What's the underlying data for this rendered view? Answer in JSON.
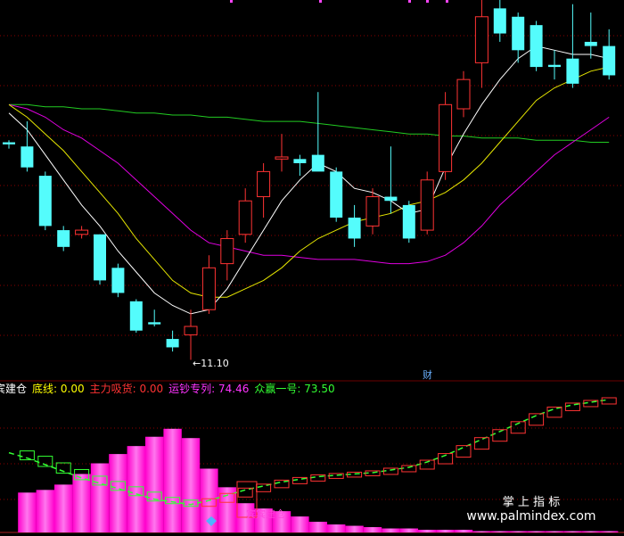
{
  "indicator_legend": [
    {
      "name": "宾建仓",
      "value": "",
      "color": "#ffffff"
    },
    {
      "name": "底线",
      "value": "0.00",
      "color": "#ffff00"
    },
    {
      "name": "主力吸货",
      "value": "0.00",
      "color": "#ff3333"
    },
    {
      "name": "运钞专列",
      "value": "74.46",
      "color": "#ff33ff"
    },
    {
      "name": "众赢一号",
      "value": "73.50",
      "color": "#33ff33"
    }
  ],
  "annotations": {
    "low_price": "←11.10",
    "finance_marker": "财",
    "buy_signal": "宾宾建仓"
  },
  "watermark": {
    "line1": "掌 上 指 标",
    "line2": "www.palmindex.com"
  },
  "colors": {
    "up": "#ff3333",
    "down": "#54fcfc",
    "ma_white": "#ffffff",
    "ma_yellow": "#e6e600",
    "ma_magenta": "#e000e0",
    "ma_green": "#22cc22",
    "bars": "#ff33cc",
    "grid": "#8b0000"
  },
  "chart_data": [
    {
      "type": "candlestick",
      "title": "",
      "yrange": [
        10.6,
        19.7
      ],
      "candles": [
        {
          "o": 16.3,
          "h": 16.35,
          "l": 16.15,
          "c": 16.25
        },
        {
          "o": 16.2,
          "h": 16.8,
          "l": 15.6,
          "c": 15.7
        },
        {
          "o": 15.5,
          "h": 15.6,
          "l": 14.2,
          "c": 14.3
        },
        {
          "o": 14.2,
          "h": 14.3,
          "l": 13.7,
          "c": 13.8
        },
        {
          "o": 14.1,
          "h": 14.3,
          "l": 14.0,
          "c": 14.2
        },
        {
          "o": 14.1,
          "h": 14.1,
          "l": 12.9,
          "c": 13.0
        },
        {
          "o": 13.3,
          "h": 13.4,
          "l": 12.6,
          "c": 12.7
        },
        {
          "o": 12.5,
          "h": 12.55,
          "l": 11.75,
          "c": 11.8
        },
        {
          "o": 12.0,
          "h": 12.3,
          "l": 11.9,
          "c": 11.95
        },
        {
          "o": 11.6,
          "h": 11.8,
          "l": 11.3,
          "c": 11.4
        },
        {
          "o": 11.7,
          "h": 12.3,
          "l": 11.1,
          "c": 11.9
        },
        {
          "o": 12.3,
          "h": 13.6,
          "l": 12.2,
          "c": 13.3
        },
        {
          "o": 13.4,
          "h": 14.2,
          "l": 13.0,
          "c": 14.0
        },
        {
          "o": 14.1,
          "h": 15.2,
          "l": 13.9,
          "c": 14.9
        },
        {
          "o": 15.0,
          "h": 15.8,
          "l": 14.5,
          "c": 15.6
        },
        {
          "o": 15.9,
          "h": 16.5,
          "l": 15.6,
          "c": 15.95
        },
        {
          "o": 15.9,
          "h": 16.0,
          "l": 15.5,
          "c": 15.8
        },
        {
          "o": 16.0,
          "h": 17.5,
          "l": 15.7,
          "c": 15.6
        },
        {
          "o": 15.6,
          "h": 15.7,
          "l": 14.4,
          "c": 14.5
        },
        {
          "o": 14.5,
          "h": 14.8,
          "l": 13.8,
          "c": 14.0
        },
        {
          "o": 14.3,
          "h": 15.2,
          "l": 14.1,
          "c": 15.0
        },
        {
          "o": 15.0,
          "h": 16.2,
          "l": 14.6,
          "c": 14.9
        },
        {
          "o": 14.8,
          "h": 14.9,
          "l": 13.9,
          "c": 14.0
        },
        {
          "o": 14.2,
          "h": 15.6,
          "l": 14.1,
          "c": 15.4
        },
        {
          "o": 15.6,
          "h": 17.5,
          "l": 15.4,
          "c": 17.2
        },
        {
          "o": 17.1,
          "h": 18.0,
          "l": 16.9,
          "c": 17.8
        },
        {
          "o": 18.2,
          "h": 19.7,
          "l": 17.6,
          "c": 19.3
        },
        {
          "o": 19.5,
          "h": 19.7,
          "l": 18.7,
          "c": 18.9
        },
        {
          "o": 19.3,
          "h": 19.4,
          "l": 18.2,
          "c": 18.5
        },
        {
          "o": 19.1,
          "h": 19.2,
          "l": 18.0,
          "c": 18.1
        },
        {
          "o": 18.15,
          "h": 18.5,
          "l": 17.8,
          "c": 18.1
        },
        {
          "o": 18.3,
          "h": 19.6,
          "l": 17.6,
          "c": 17.7
        },
        {
          "o": 18.7,
          "h": 19.4,
          "l": 18.3,
          "c": 18.6
        },
        {
          "o": 18.6,
          "h": 19.0,
          "l": 17.8,
          "c": 17.9
        }
      ],
      "ma_white": [
        17.0,
        16.6,
        16.0,
        15.4,
        14.8,
        14.3,
        13.7,
        13.2,
        12.7,
        12.4,
        12.2,
        12.3,
        12.8,
        13.5,
        14.2,
        14.9,
        15.4,
        15.8,
        15.6,
        15.2,
        15.1,
        14.9,
        14.6,
        14.7,
        15.7,
        16.5,
        17.2,
        17.8,
        18.3,
        18.6,
        18.5,
        18.4,
        18.4,
        18.3
      ],
      "ma_yellow": [
        17.2,
        16.9,
        16.5,
        16.1,
        15.6,
        15.1,
        14.6,
        14.0,
        13.5,
        13.0,
        12.7,
        12.6,
        12.6,
        12.8,
        13.0,
        13.3,
        13.7,
        14.0,
        14.2,
        14.4,
        14.5,
        14.6,
        14.8,
        14.9,
        15.1,
        15.4,
        15.8,
        16.3,
        16.8,
        17.3,
        17.6,
        17.8,
        18.0,
        18.1
      ],
      "ma_magenta": [
        17.2,
        17.1,
        16.9,
        16.6,
        16.4,
        16.1,
        15.8,
        15.4,
        15.0,
        14.6,
        14.2,
        13.9,
        13.8,
        13.7,
        13.6,
        13.6,
        13.55,
        13.5,
        13.5,
        13.5,
        13.45,
        13.4,
        13.4,
        13.45,
        13.6,
        13.9,
        14.3,
        14.8,
        15.2,
        15.6,
        16.0,
        16.3,
        16.6,
        16.9
      ],
      "ma_green": [
        17.2,
        17.2,
        17.15,
        17.15,
        17.1,
        17.1,
        17.05,
        17.0,
        17.0,
        16.95,
        16.95,
        16.9,
        16.9,
        16.85,
        16.8,
        16.8,
        16.8,
        16.75,
        16.7,
        16.65,
        16.6,
        16.55,
        16.5,
        16.5,
        16.45,
        16.45,
        16.4,
        16.4,
        16.4,
        16.35,
        16.35,
        16.35,
        16.3,
        16.3
      ]
    },
    {
      "type": "bar",
      "title": "",
      "yrange": [
        0,
        100
      ],
      "bars": [
        0,
        30,
        32,
        36,
        44,
        52,
        59,
        65,
        72,
        78,
        71,
        48,
        34,
        22,
        18,
        16,
        12,
        8,
        6,
        5,
        4,
        3,
        3,
        2,
        2,
        2,
        1,
        1,
        1,
        1,
        1,
        1,
        1,
        1
      ],
      "line": [
        60,
        56,
        51,
        46,
        41,
        37,
        33,
        29,
        25,
        23,
        21,
        24,
        28,
        32,
        35,
        38,
        40,
        42,
        43,
        44,
        45,
        47,
        49,
        53,
        58,
        64,
        70,
        76,
        82,
        88,
        93,
        96,
        98,
        100
      ]
    }
  ]
}
